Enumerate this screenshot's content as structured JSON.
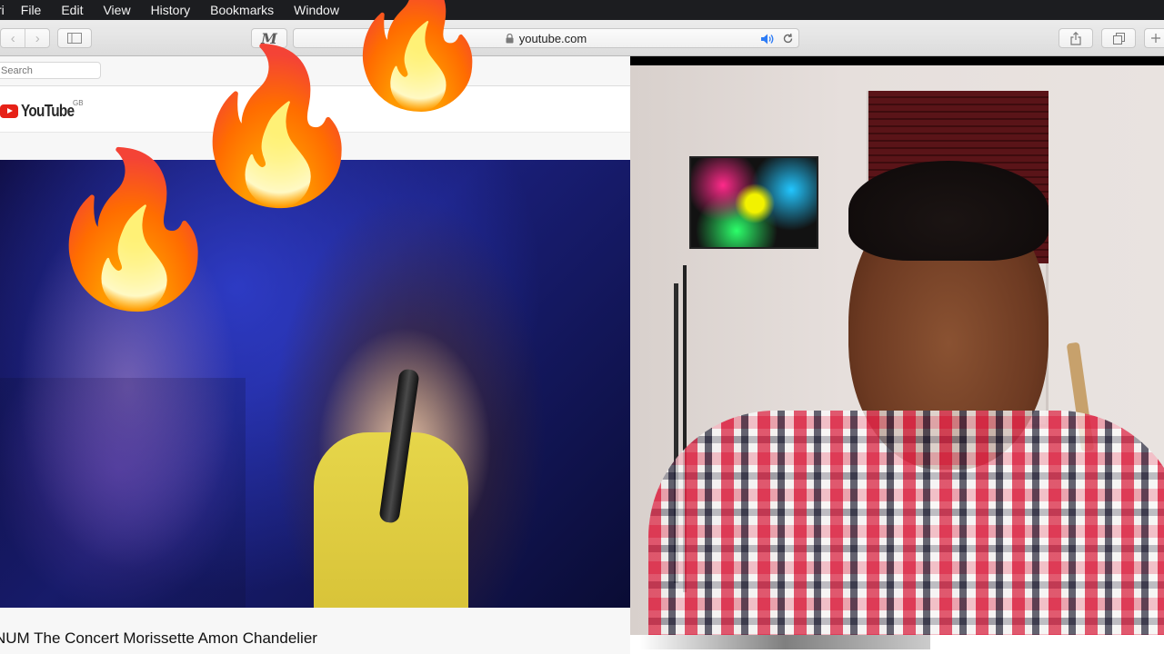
{
  "menubar": {
    "app": "ri",
    "items": [
      "File",
      "Edit",
      "View",
      "History",
      "Bookmarks",
      "Window"
    ]
  },
  "toolbar": {
    "back_glyph": "‹",
    "forward_glyph": "›",
    "reader_glyph": "M",
    "url": "youtube.com",
    "icons": [
      "back-icon",
      "forward-icon",
      "sidebar-icon",
      "reader-icon",
      "lock-icon",
      "speaker-icon",
      "reload-icon",
      "share-icon",
      "tabs-icon",
      "plus-icon"
    ]
  },
  "sidebar_search": {
    "placeholder": "Search"
  },
  "youtube": {
    "logo_text": "YouTube",
    "region": "GB",
    "video_title": "NUM The Concert Morissette Amon Chandelier"
  },
  "overlay": {
    "emoji": "🔥"
  },
  "colors": {
    "youtube_red": "#e62117",
    "menubar_bg": "#1c1d20",
    "toolbar_bg": "#e3e3e3",
    "speaker_blue": "#2d7cf6"
  }
}
